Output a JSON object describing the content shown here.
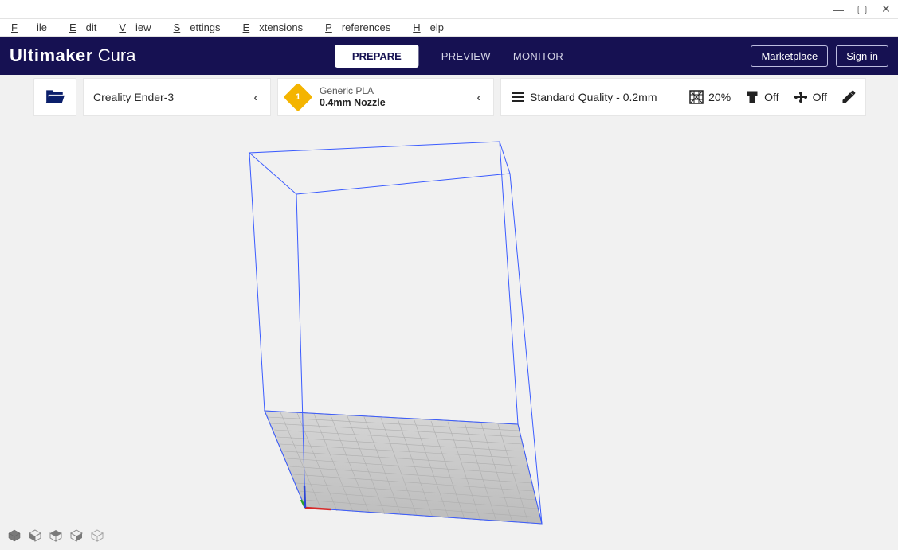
{
  "window": {
    "controls": {
      "minimize": "—",
      "maximize": "▢",
      "close": "✕"
    }
  },
  "menu": {
    "file": "File",
    "edit": "Edit",
    "view": "View",
    "settings": "Settings",
    "extensions": "Extensions",
    "preferences": "Preferences",
    "help": "Help"
  },
  "brand": {
    "part1": "Ultimaker",
    "part2": "Cura"
  },
  "tabs": {
    "prepare": "PREPARE",
    "preview": "PREVIEW",
    "monitor": "MONITOR"
  },
  "header_actions": {
    "marketplace": "Marketplace",
    "sign_in": "Sign in"
  },
  "printer": {
    "name": "Creality Ender-3"
  },
  "material": {
    "name": "Generic PLA",
    "nozzle": "0.4mm Nozzle",
    "badge": "1"
  },
  "print_settings": {
    "quality": "Standard Quality - 0.2mm",
    "infill": "20%",
    "support": "Off",
    "adhesion": "Off"
  },
  "icons": {
    "folder": "folder-open-icon",
    "chevron_left": "‹",
    "lines": "layers-icon",
    "infill": "infill-icon",
    "support": "support-icon",
    "adhesion": "adhesion-icon",
    "pencil": "pencil-icon"
  }
}
